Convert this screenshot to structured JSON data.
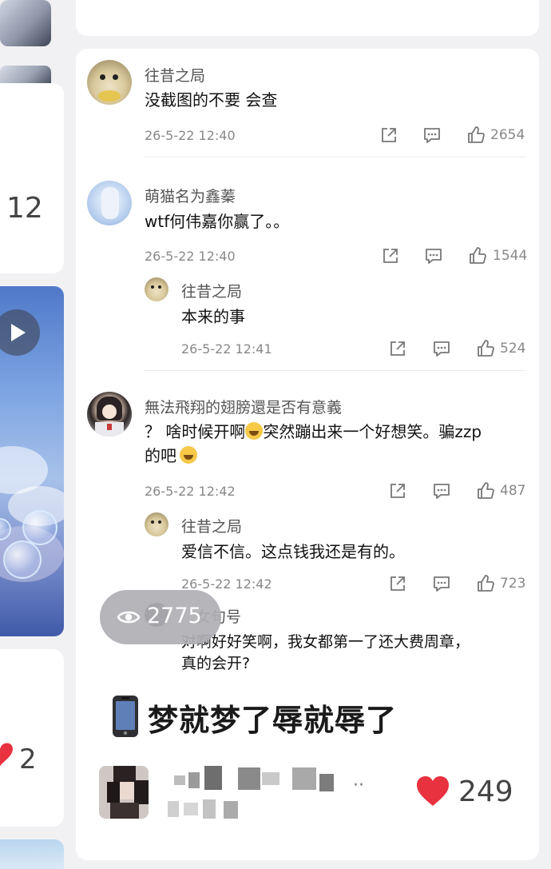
{
  "left_column": {
    "count_top": "12",
    "count_bottom": "2"
  },
  "comments": [
    {
      "author": "往昔之局",
      "text": "没截图的不要 会查",
      "time": "26-5-22 12:40",
      "likes": "2654"
    },
    {
      "author": "萌猫名为鑫蓁",
      "text": "wtf何伟嘉你赢了。。",
      "time": "26-5-22 12:40",
      "likes": "1544",
      "reply": {
        "author": "往昔之局",
        "text": "本来的事",
        "time": "26-5-22 12:41",
        "likes": "524"
      }
    },
    {
      "author": "無法飛翔的翅膀還是否有意義",
      "text_line1_part1": "？ 啥时候开啊",
      "text_line1_part2": "突然蹦出来一个好想笑。骗zzp",
      "text_line2": "的吧",
      "time": "26-5-22 12:42",
      "likes": "487",
      "reply": {
        "author": "往昔之局",
        "text": "爱信不信。这点钱我还是有的。",
        "time": "26-5-22 12:42",
        "likes": "723"
      }
    },
    {
      "author_partial": "女句号",
      "text_line1": "对啊好好笑啊，我女都第一了还大费周章，",
      "text_line2": "真的会开?"
    }
  ],
  "views_badge": "2775",
  "post_title": "梦就梦了辱就辱了",
  "post_likes": "249",
  "colors": {
    "heart": "#e8323f",
    "card": "#ffffff",
    "background": "#f1f1f3"
  },
  "icons": [
    "share-icon",
    "comment-icon",
    "thumbs-up-icon",
    "eye-icon",
    "phone-icon",
    "heart-icon",
    "play-icon"
  ]
}
